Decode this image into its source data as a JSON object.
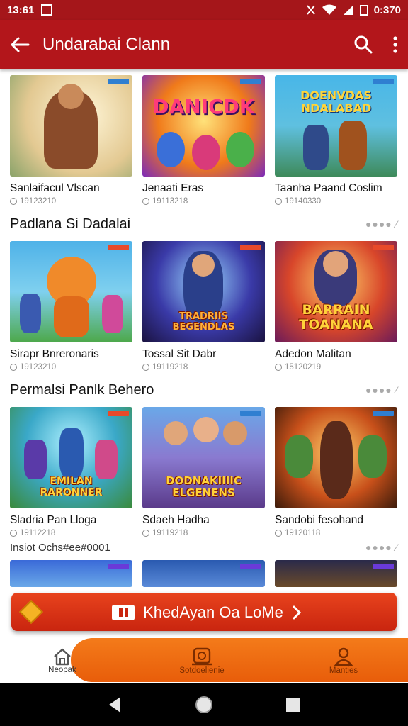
{
  "status_bar": {
    "time": "13:61",
    "clock": "0:370"
  },
  "app_bar": {
    "title": "Undarabai Clann"
  },
  "sections": [
    {
      "title": "",
      "cards": [
        {
          "title": "Sanlaifacul Vlscan",
          "meta": "19123210",
          "logo": ""
        },
        {
          "title": "Jenaati Eras",
          "meta": "19113218",
          "logo": "DANICDK"
        },
        {
          "title": "Taanha Paand Coslim",
          "meta": "19140330",
          "logo": "DOENVDAS NDALABAD"
        }
      ]
    },
    {
      "title": "Padlana Si Dadalai",
      "cards": [
        {
          "title": "Sirapr Bnreronaris",
          "meta": "19123210",
          "logo": ""
        },
        {
          "title": "Tossal Sit Dabr",
          "meta": "19119218",
          "logo": "TRADRIIS BEGENDLAS"
        },
        {
          "title": "Adedon Malitan",
          "meta": "15120219",
          "logo": "BARRAIN TOANANA"
        }
      ]
    },
    {
      "title": "Permalsi Panlk Behero",
      "cards": [
        {
          "title": "Sladria Pan Lloga",
          "meta": "19112218",
          "logo": "EMILAN RARONNER"
        },
        {
          "title": "Sdaeh Hadha",
          "meta": "19119218",
          "logo": "DODNAKIIIIC ELGENENS"
        },
        {
          "title": "Sandobi fesohand",
          "meta": "19120118",
          "logo": ""
        }
      ]
    }
  ],
  "note_line": "Insiot Ochs#ee#0001",
  "cta": {
    "label": "KhedAyan Oa LoMe"
  },
  "bottom_nav": {
    "home": "Neopak",
    "mid": "Sotdoelienie",
    "right": "Manties"
  },
  "colors": {
    "app_bar": "#b3161b",
    "status_bar": "#a5161a",
    "cta": "#d9301a",
    "nav_accent": "#f06a12"
  }
}
